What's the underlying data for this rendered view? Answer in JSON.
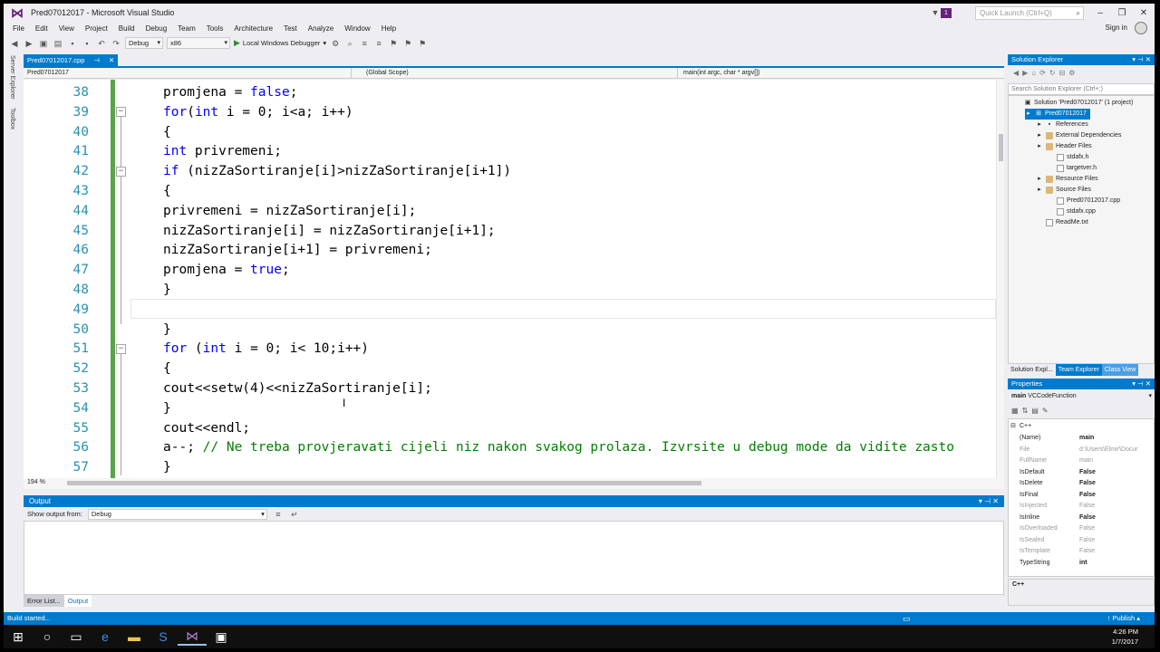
{
  "window": {
    "title": "Pred07012017 - Microsoft Visual Studio",
    "quick_launch_placeholder": "Quick Launch (Ctrl+Q)",
    "notification_count": "1",
    "sign_in": "Sign in"
  },
  "menu": [
    "File",
    "Edit",
    "View",
    "Project",
    "Build",
    "Debug",
    "Team",
    "Tools",
    "Architecture",
    "Test",
    "Analyze",
    "Window",
    "Help"
  ],
  "toolbar": {
    "config": "Debug",
    "platform": "x86",
    "run_label": "Local Windows Debugger"
  },
  "left_strip": {
    "server_explorer": "Server Explorer",
    "toolbox": "Toolbox"
  },
  "editor": {
    "tab_label": "Pred07012017.cpp",
    "nav_project": "Pred07012017",
    "nav_scope": "(Global Scope)",
    "nav_function": "main(int argc, char * argv[])",
    "zoom": "194 %",
    "lines": [
      {
        "num": "38",
        "tokens": [
          {
            "t": "promjena = "
          },
          {
            "t": "false",
            "k": 1
          },
          {
            "t": ";"
          }
        ]
      },
      {
        "num": "39",
        "tokens": [
          {
            "t": "for",
            "k": 1
          },
          {
            "t": "("
          },
          {
            "t": "int",
            "k": 1
          },
          {
            "t": " i = 0; i<a; i++)"
          }
        ]
      },
      {
        "num": "40",
        "tokens": [
          {
            "t": "{"
          }
        ]
      },
      {
        "num": "41",
        "tokens": [
          {
            "t": "int",
            "k": 1
          },
          {
            "t": " privremeni;"
          }
        ]
      },
      {
        "num": "42",
        "tokens": [
          {
            "t": "if",
            "k": 1
          },
          {
            "t": " (nizZaSortiranje[i]>nizZaSortiranje[i+1])"
          }
        ]
      },
      {
        "num": "43",
        "tokens": [
          {
            "t": "{"
          }
        ]
      },
      {
        "num": "44",
        "tokens": [
          {
            "t": "privremeni = nizZaSortiranje[i];"
          }
        ]
      },
      {
        "num": "45",
        "tokens": [
          {
            "t": "nizZaSortiranje[i] = nizZaSortiranje[i+1];"
          }
        ]
      },
      {
        "num": "46",
        "tokens": [
          {
            "t": "nizZaSortiranje[i+1] = privremeni;"
          }
        ]
      },
      {
        "num": "47",
        "tokens": [
          {
            "t": "promjena = "
          },
          {
            "t": "true",
            "k": 1
          },
          {
            "t": ";"
          }
        ]
      },
      {
        "num": "48",
        "tokens": [
          {
            "t": "}"
          }
        ]
      },
      {
        "num": "49",
        "tokens": []
      },
      {
        "num": "50",
        "tokens": [
          {
            "t": "}"
          }
        ]
      },
      {
        "num": "51",
        "tokens": [
          {
            "t": "for",
            "k": 1
          },
          {
            "t": " ("
          },
          {
            "t": "int",
            "k": 1
          },
          {
            "t": " i = 0; i< 10;i++)"
          }
        ]
      },
      {
        "num": "52",
        "tokens": [
          {
            "t": "{"
          }
        ]
      },
      {
        "num": "53",
        "tokens": [
          {
            "t": "cout<<setw(4)<<nizZaSortiranje[i];"
          }
        ]
      },
      {
        "num": "54",
        "tokens": [
          {
            "t": "}"
          }
        ]
      },
      {
        "num": "55",
        "tokens": [
          {
            "t": "cout<<endl;"
          }
        ]
      },
      {
        "num": "56",
        "tokens": [
          {
            "t": "a--; "
          },
          {
            "t": "// Ne treba provjeravati cijeli niz nakon svakog prolaza. Izvrsite u debug mode da vidite zasto",
            "c": 1
          }
        ]
      },
      {
        "num": "57",
        "tokens": [
          {
            "t": "}"
          }
        ]
      }
    ]
  },
  "output": {
    "title": "Output",
    "show_from_label": "Show output from:",
    "show_from_value": "Debug",
    "tabs": [
      "Error List...",
      "Output"
    ]
  },
  "solution_explorer": {
    "title": "Solution Explorer",
    "search_placeholder": "Search Solution Explorer (Ctrl+;)",
    "tree": [
      {
        "label": "Solution 'Pred07012017' (1 project)",
        "depth": 0,
        "icon": "solution-icon"
      },
      {
        "label": "Pred07012017",
        "depth": 1,
        "icon": "project-icon",
        "selected": true
      },
      {
        "label": "References",
        "depth": 2,
        "icon": "references-icon"
      },
      {
        "label": "External Dependencies",
        "depth": 2,
        "icon": "folder-icon"
      },
      {
        "label": "Header Files",
        "depth": 2,
        "icon": "folder-icon"
      },
      {
        "label": "stdafx.h",
        "depth": 3,
        "icon": "file-icon"
      },
      {
        "label": "targetver.h",
        "depth": 3,
        "icon": "file-icon"
      },
      {
        "label": "Resource Files",
        "depth": 2,
        "icon": "folder-icon"
      },
      {
        "label": "Source Files",
        "depth": 2,
        "icon": "folder-icon"
      },
      {
        "label": "Pred07012017.cpp",
        "depth": 3,
        "icon": "file-icon"
      },
      {
        "label": "stdafx.cpp",
        "depth": 3,
        "icon": "file-icon"
      },
      {
        "label": "ReadMe.txt",
        "depth": 2,
        "icon": "file-icon"
      }
    ],
    "tabs": [
      "Solution Expl...",
      "Team Explorer",
      "Class View"
    ]
  },
  "properties": {
    "title": "Properties",
    "selected": "main",
    "selected_type": "VCCodeFunction",
    "category": "C++",
    "rows": [
      {
        "name": "(Name)",
        "value": "main",
        "bold": true
      },
      {
        "name": "File",
        "value": "d:\\Users\\Elmir\\Docur",
        "grey": true
      },
      {
        "name": "FullName",
        "value": "main",
        "grey": true
      },
      {
        "name": "IsDefault",
        "value": "False",
        "bold": true
      },
      {
        "name": "IsDelete",
        "value": "False",
        "bold": true
      },
      {
        "name": "IsFinal",
        "value": "False",
        "bold": true
      },
      {
        "name": "IsInjected",
        "value": "False",
        "grey": true
      },
      {
        "name": "IsInline",
        "value": "False",
        "bold": true
      },
      {
        "name": "IsOverloaded",
        "value": "False",
        "grey": true
      },
      {
        "name": "IsSealed",
        "value": "False",
        "grey": true
      },
      {
        "name": "IsTemplate",
        "value": "False",
        "grey": true
      },
      {
        "name": "TypeString",
        "value": "int",
        "bold": true
      }
    ],
    "description": "C++"
  },
  "status": {
    "left": "Build started...",
    "publish": "Publish"
  },
  "taskbar": {
    "time": "4:26 PM",
    "date": "1/7/2017"
  }
}
